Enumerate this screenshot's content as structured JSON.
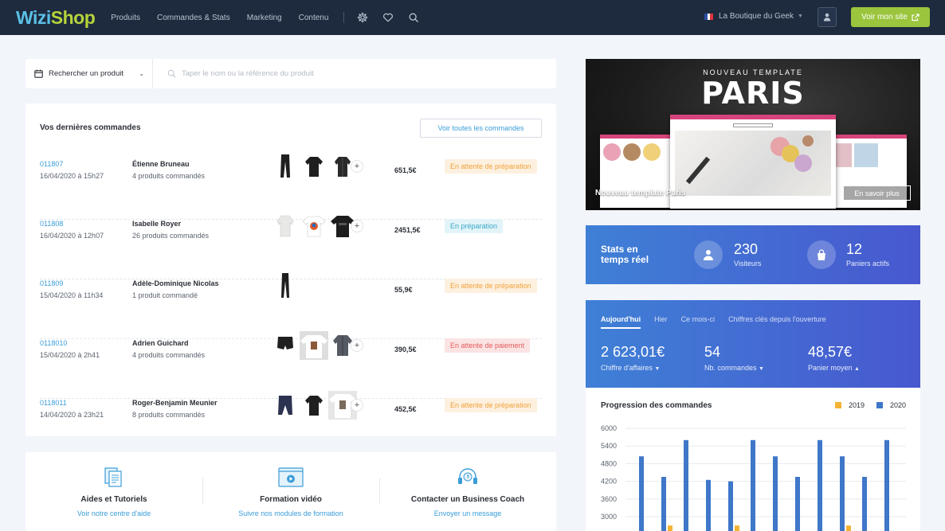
{
  "brand": {
    "part1": "Wizi",
    "part2": "Shop"
  },
  "nav": {
    "items": [
      "Produits",
      "Commandes & Stats",
      "Marketing",
      "Contenu"
    ]
  },
  "header": {
    "shop_name": "La Boutique du Geek",
    "site_button": "Voir mon site"
  },
  "search": {
    "type_label": "Rechercher un produit",
    "placeholder": "Taper le nom ou la référence du produit"
  },
  "orders": {
    "title": "Vos dernières commandes",
    "all_button": "Voir toutes les commandes",
    "rows": [
      {
        "id": "011807",
        "date": "16/04/2020 à 15h27",
        "name": "Étienne Bruneau",
        "count": "4 produits commandés",
        "amount": "651,5€",
        "status": "En attente de préparation",
        "status_kind": "wait"
      },
      {
        "id": "011808",
        "date": "16/04/2020 à 12h07",
        "name": "Isabelle Royer",
        "count": "26 produits commandés",
        "amount": "2451,5€",
        "status": "En préparation",
        "status_kind": "prep"
      },
      {
        "id": "011809",
        "date": "15/04/2020 à 11h34",
        "name": "Adèle-Dominique Nicolas",
        "count": "1 produit commandé",
        "amount": "55,9€",
        "status": "En attente de préparation",
        "status_kind": "wait"
      },
      {
        "id": "0118010",
        "date": "15/04/2020 à 2h41",
        "name": "Adrien Guichard",
        "count": "4 produits commandés",
        "amount": "390,5€",
        "status": "En attente de paiement",
        "status_kind": "pay"
      },
      {
        "id": "0118011",
        "date": "14/04/2020 à 23h21",
        "name": "Roger-Benjamin Meunier",
        "count": "8 produits commandés",
        "amount": "452,5€",
        "status": "En attente de préparation",
        "status_kind": "wait"
      }
    ]
  },
  "help": [
    {
      "title": "Aides et Tutoriels",
      "link": "Voir notre centre d'aide"
    },
    {
      "title": "Formation vidéo",
      "link": "Suivre nos modules de formation"
    },
    {
      "title": "Contacter un Business Coach",
      "link": "Envoyer un message"
    }
  ],
  "banner": {
    "kicker": "NOUVEAU TEMPLATE",
    "title": "PARIS",
    "caption": "Nouveau template Paris",
    "button": "En savoir plus"
  },
  "live": {
    "title": "Stats en temps réel",
    "visitors_value": "230",
    "visitors_label": "Visiteurs",
    "carts_value": "12",
    "carts_label": "Paniers actifs"
  },
  "kpi": {
    "tabs": [
      "Aujourd'hui",
      "Hier",
      "Ce mois-ci",
      "Chiffres clés depuis l'ouverture"
    ],
    "active_tab": 0,
    "revenue_value": "2 623,01€",
    "revenue_label": "Chiffre d'affaires",
    "orders_value": "54",
    "orders_label": "Nb. commandes",
    "basket_value": "48,57€",
    "basket_label": "Panier moyen"
  },
  "chart_data": {
    "type": "bar",
    "title": "Progression des commandes",
    "yticks": [
      "6000",
      "5400",
      "4800",
      "4200",
      "3600",
      "3000"
    ],
    "ylim": [
      2600,
      6000
    ],
    "series": [
      {
        "name": "2019",
        "color": "#f5b335",
        "values": [
          null,
          2700,
          null,
          null,
          2700,
          null,
          null,
          null,
          null,
          2700,
          null,
          null
        ]
      },
      {
        "name": "2020",
        "color": "#3f77c9",
        "values": [
          5050,
          4350,
          5600,
          4250,
          4200,
          5600,
          5050,
          4350,
          5600,
          5050,
          4350,
          5600
        ]
      }
    ]
  },
  "colors": {
    "topbar": "#1e2b3e",
    "accent_green": "#9bc53d",
    "link_blue": "#3a9dd8",
    "gradient_start": "#3f80d6",
    "gradient_end": "#4858cf"
  }
}
